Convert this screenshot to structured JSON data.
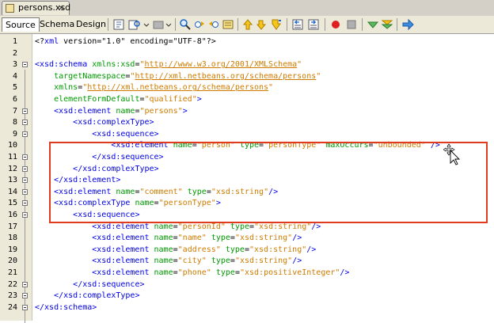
{
  "file_tab": {
    "label": "persons.xsd",
    "close": "×"
  },
  "view_tabs": [
    "Source",
    "Schema",
    "Design"
  ],
  "lines": [
    {
      "n": "1",
      "parts": [
        {
          "c": "p",
          "s": "<?"
        },
        {
          "c": "t",
          "s": "xml"
        },
        {
          "c": "p",
          "s": " version=\"1.0\" encoding=\"UTF-8\"?>"
        }
      ]
    },
    {
      "n": "2",
      "parts": []
    },
    {
      "n": "3",
      "parts": [
        {
          "c": "t",
          "s": "<xsd:schema"
        },
        {
          "c": "p",
          "s": " "
        },
        {
          "c": "a",
          "s": "xmlns:xsd"
        },
        {
          "c": "p",
          "s": "="
        },
        {
          "c": "v",
          "s": "\""
        },
        {
          "c": "u",
          "s": "http://www.w3.org/2001/XMLSchema"
        },
        {
          "c": "v",
          "s": "\""
        }
      ]
    },
    {
      "n": "4",
      "parts": [
        {
          "c": "p",
          "s": "    "
        },
        {
          "c": "a",
          "s": "targetNamespace"
        },
        {
          "c": "p",
          "s": "="
        },
        {
          "c": "v",
          "s": "\""
        },
        {
          "c": "u",
          "s": "http://xml.netbeans.org/schema/persons"
        },
        {
          "c": "v",
          "s": "\""
        }
      ]
    },
    {
      "n": "5",
      "parts": [
        {
          "c": "p",
          "s": "    "
        },
        {
          "c": "a",
          "s": "xmlns"
        },
        {
          "c": "p",
          "s": "="
        },
        {
          "c": "v",
          "s": "\""
        },
        {
          "c": "u",
          "s": "http://xml.netbeans.org/schema/persons"
        },
        {
          "c": "v",
          "s": "\""
        }
      ]
    },
    {
      "n": "6",
      "parts": [
        {
          "c": "p",
          "s": "    "
        },
        {
          "c": "a",
          "s": "elementFormDefault"
        },
        {
          "c": "p",
          "s": "="
        },
        {
          "c": "v",
          "s": "\"qualified\""
        },
        {
          "c": "t",
          "s": ">"
        }
      ]
    },
    {
      "n": "7",
      "parts": [
        {
          "c": "p",
          "s": "    "
        },
        {
          "c": "t",
          "s": "<xsd:element"
        },
        {
          "c": "p",
          "s": " "
        },
        {
          "c": "a",
          "s": "name"
        },
        {
          "c": "p",
          "s": "="
        },
        {
          "c": "v",
          "s": "\"persons\""
        },
        {
          "c": "t",
          "s": ">"
        }
      ]
    },
    {
      "n": "8",
      "parts": [
        {
          "c": "p",
          "s": "        "
        },
        {
          "c": "t",
          "s": "<xsd:complexType>"
        }
      ]
    },
    {
      "n": "9",
      "parts": [
        {
          "c": "p",
          "s": "            "
        },
        {
          "c": "t",
          "s": "<xsd:sequence>"
        }
      ]
    },
    {
      "n": "10",
      "parts": [
        {
          "c": "p",
          "s": "                "
        },
        {
          "c": "t",
          "s": "<xsd:element"
        },
        {
          "c": "p",
          "s": " "
        },
        {
          "c": "a",
          "s": "name"
        },
        {
          "c": "p",
          "s": "="
        },
        {
          "c": "v",
          "s": "\"person\""
        },
        {
          "c": "p",
          "s": " "
        },
        {
          "c": "a",
          "s": "type"
        },
        {
          "c": "p",
          "s": "="
        },
        {
          "c": "v",
          "s": "\"personType\""
        },
        {
          "c": "p",
          "s": " "
        },
        {
          "c": "a",
          "s": "maxOccurs"
        },
        {
          "c": "p",
          "s": "="
        },
        {
          "c": "v",
          "s": "\"unbounded\""
        },
        {
          "c": "p",
          "s": " "
        },
        {
          "c": "t",
          "s": "/>"
        }
      ]
    },
    {
      "n": "11",
      "parts": [
        {
          "c": "p",
          "s": "            "
        },
        {
          "c": "t",
          "s": "</xsd:sequence>"
        }
      ]
    },
    {
      "n": "12",
      "parts": [
        {
          "c": "p",
          "s": "        "
        },
        {
          "c": "t",
          "s": "</xsd:complexType>"
        }
      ]
    },
    {
      "n": "13",
      "parts": [
        {
          "c": "p",
          "s": "    "
        },
        {
          "c": "t",
          "s": "</xsd:element>"
        }
      ]
    },
    {
      "n": "14",
      "parts": [
        {
          "c": "p",
          "s": "    "
        },
        {
          "c": "t",
          "s": "<xsd:element"
        },
        {
          "c": "p",
          "s": " "
        },
        {
          "c": "a",
          "s": "name"
        },
        {
          "c": "p",
          "s": "="
        },
        {
          "c": "v",
          "s": "\"comment\""
        },
        {
          "c": "p",
          "s": " "
        },
        {
          "c": "a",
          "s": "type"
        },
        {
          "c": "p",
          "s": "="
        },
        {
          "c": "v",
          "s": "\"xsd:string\""
        },
        {
          "c": "t",
          "s": "/>"
        }
      ]
    },
    {
      "n": "15",
      "parts": [
        {
          "c": "p",
          "s": "    "
        },
        {
          "c": "t",
          "s": "<xsd:complexType"
        },
        {
          "c": "p",
          "s": " "
        },
        {
          "c": "a",
          "s": "name"
        },
        {
          "c": "p",
          "s": "="
        },
        {
          "c": "v",
          "s": "\"personType\""
        },
        {
          "c": "t",
          "s": ">"
        }
      ]
    },
    {
      "n": "16",
      "parts": [
        {
          "c": "p",
          "s": "        "
        },
        {
          "c": "t",
          "s": "<xsd:sequence>"
        }
      ]
    },
    {
      "n": "17",
      "parts": [
        {
          "c": "p",
          "s": "            "
        },
        {
          "c": "t",
          "s": "<xsd:element"
        },
        {
          "c": "p",
          "s": " "
        },
        {
          "c": "a",
          "s": "name"
        },
        {
          "c": "p",
          "s": "="
        },
        {
          "c": "v",
          "s": "\"personId\""
        },
        {
          "c": "p",
          "s": " "
        },
        {
          "c": "a",
          "s": "type"
        },
        {
          "c": "p",
          "s": "="
        },
        {
          "c": "v",
          "s": "\"xsd:string\""
        },
        {
          "c": "t",
          "s": "/>"
        }
      ]
    },
    {
      "n": "18",
      "parts": [
        {
          "c": "p",
          "s": "            "
        },
        {
          "c": "t",
          "s": "<xsd:element"
        },
        {
          "c": "p",
          "s": " "
        },
        {
          "c": "a",
          "s": "name"
        },
        {
          "c": "p",
          "s": "="
        },
        {
          "c": "v",
          "s": "\"name\""
        },
        {
          "c": "p",
          "s": " "
        },
        {
          "c": "a",
          "s": "type"
        },
        {
          "c": "p",
          "s": "="
        },
        {
          "c": "v",
          "s": "\"xsd:string\""
        },
        {
          "c": "t",
          "s": "/>"
        }
      ]
    },
    {
      "n": "19",
      "parts": [
        {
          "c": "p",
          "s": "            "
        },
        {
          "c": "t",
          "s": "<xsd:element"
        },
        {
          "c": "p",
          "s": " "
        },
        {
          "c": "a",
          "s": "name"
        },
        {
          "c": "p",
          "s": "="
        },
        {
          "c": "v",
          "s": "\"address\""
        },
        {
          "c": "p",
          "s": " "
        },
        {
          "c": "a",
          "s": "type"
        },
        {
          "c": "p",
          "s": "="
        },
        {
          "c": "v",
          "s": "\"xsd:string\""
        },
        {
          "c": "t",
          "s": "/>"
        }
      ]
    },
    {
      "n": "20",
      "parts": [
        {
          "c": "p",
          "s": "            "
        },
        {
          "c": "t",
          "s": "<xsd:element"
        },
        {
          "c": "p",
          "s": " "
        },
        {
          "c": "a",
          "s": "name"
        },
        {
          "c": "p",
          "s": "="
        },
        {
          "c": "v",
          "s": "\"city\""
        },
        {
          "c": "p",
          "s": " "
        },
        {
          "c": "a",
          "s": "type"
        },
        {
          "c": "p",
          "s": "="
        },
        {
          "c": "v",
          "s": "\"xsd:string\""
        },
        {
          "c": "t",
          "s": "/>"
        }
      ]
    },
    {
      "n": "21",
      "parts": [
        {
          "c": "p",
          "s": "            "
        },
        {
          "c": "t",
          "s": "<xsd:element"
        },
        {
          "c": "p",
          "s": " "
        },
        {
          "c": "a",
          "s": "name"
        },
        {
          "c": "p",
          "s": "="
        },
        {
          "c": "v",
          "s": "\"phone\""
        },
        {
          "c": "p",
          "s": " "
        },
        {
          "c": "a",
          "s": "type"
        },
        {
          "c": "p",
          "s": "="
        },
        {
          "c": "v",
          "s": "\"xsd:positiveInteger\""
        },
        {
          "c": "t",
          "s": "/>"
        }
      ]
    },
    {
      "n": "22",
      "parts": [
        {
          "c": "p",
          "s": "        "
        },
        {
          "c": "t",
          "s": "</xsd:sequence>"
        }
      ]
    },
    {
      "n": "23",
      "parts": [
        {
          "c": "p",
          "s": "    "
        },
        {
          "c": "t",
          "s": "</xsd:complexType>"
        }
      ]
    },
    {
      "n": "24",
      "parts": [
        {
          "c": "t",
          "s": "</xsd:schema>"
        }
      ]
    }
  ],
  "colors": {
    "tag": "#0000e6",
    "attribute": "#009900",
    "value": "#ce7b00",
    "highlight_border": "#e03b1f"
  },
  "icons": [
    "toggle-bookmark-icon",
    "find-selection-icon",
    "validate-icon",
    "search-icon",
    "previous-occurrence-icon",
    "next-occurrence-icon",
    "toggle-highlight-icon",
    "previous-bookmark-icon",
    "next-bookmark-icon",
    "next-error-icon",
    "shift-left-icon",
    "shift-right-icon",
    "start-macro-icon",
    "stop-macro-icon",
    "comment-icon",
    "uncomment-icon",
    "run-arrow-icon"
  ]
}
